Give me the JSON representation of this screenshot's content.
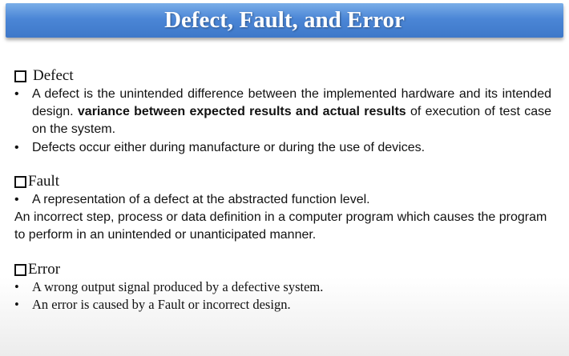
{
  "slide": {
    "title": "Defect, Fault, and Error",
    "sections": {
      "defect": {
        "heading": "Defect",
        "bullet1_part1": "A defect is the unintended difference between the implemented hardware and its intended design.",
        "bullet1_bold": "variance between expected results and actual results",
        "bullet1_part2": "of execution of test case on the system.",
        "bullet2": "Defects occur either during manufacture or during the use of devices."
      },
      "fault": {
        "heading": "Fault",
        "bullet1": "A representation of a defect at the abstracted function level.",
        "paragraph": "An incorrect step, process or data definition in a computer program which causes the program to perform in an unintended or unanticipated manner."
      },
      "error": {
        "heading": "Error",
        "bullet1": "A wrong output signal produced by a defective system.",
        "bullet2": "An error is caused by a Fault or incorrect design."
      }
    },
    "bullet_symbol": "•"
  }
}
